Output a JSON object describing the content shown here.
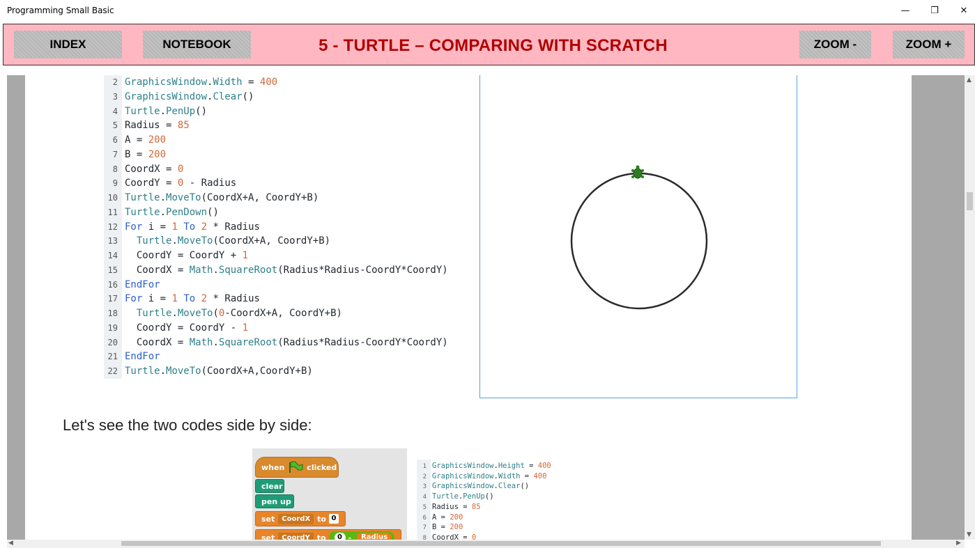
{
  "window": {
    "title": "Programming Small Basic",
    "minimize": "—",
    "restore": "❐",
    "close": "✕"
  },
  "toolbar": {
    "index_label": "INDEX",
    "notebook_label": "NOTEBOOK",
    "heading": "5 - TURTLE – COMPARING WITH SCRATCH",
    "zoom_out_label": "ZOOM -",
    "zoom_in_label": "ZOOM +"
  },
  "code_listing": {
    "lines": [
      {
        "n": "2",
        "text": "GraphicsWindow.Width = 400"
      },
      {
        "n": "3",
        "text": "GraphicsWindow.Clear()"
      },
      {
        "n": "4",
        "text": "Turtle.PenUp()"
      },
      {
        "n": "5",
        "text": "Radius = 85"
      },
      {
        "n": "6",
        "text": "A = 200"
      },
      {
        "n": "7",
        "text": "B = 200"
      },
      {
        "n": "8",
        "text": "CoordX = 0"
      },
      {
        "n": "9",
        "text": "CoordY = 0 - Radius"
      },
      {
        "n": "10",
        "text": "Turtle.MoveTo(CoordX+A, CoordY+B)"
      },
      {
        "n": "11",
        "text": "Turtle.PenDown()"
      },
      {
        "n": "12",
        "text": "For i = 1 To 2 * Radius"
      },
      {
        "n": "13",
        "text": "  Turtle.MoveTo(CoordX+A, CoordY+B)"
      },
      {
        "n": "14",
        "text": "  CoordY = CoordY + 1"
      },
      {
        "n": "15",
        "text": "  CoordX = Math.SquareRoot(Radius*Radius-CoordY*CoordY)"
      },
      {
        "n": "16",
        "text": "EndFor"
      },
      {
        "n": "17",
        "text": "For i = 1 To 2 * Radius"
      },
      {
        "n": "18",
        "text": "  Turtle.MoveTo(0-CoordX+A, CoordY+B)"
      },
      {
        "n": "19",
        "text": "  CoordY = CoordY - 1"
      },
      {
        "n": "20",
        "text": "  CoordX = Math.SquareRoot(Radius*Radius-CoordY*CoordY)"
      },
      {
        "n": "21",
        "text": "EndFor"
      },
      {
        "n": "22",
        "text": "Turtle.MoveTo(CoordX+A,CoordY+B)"
      }
    ]
  },
  "paragraph": "Let's see the two codes side by side:",
  "scratch": {
    "when_clicked_prefix": "when",
    "when_clicked_suffix": "clicked",
    "clear": "clear",
    "pen_up": "pen up",
    "set1_prefix": "set",
    "set1_var": "CoordX",
    "set1_to": "to",
    "set1_value": "0",
    "set2_prefix": "set",
    "set2_var": "CoordY",
    "set2_to": "to",
    "set2_value": "0",
    "set2_op": "-",
    "set2_rhs": "Radius"
  },
  "mini_code": {
    "lines": [
      {
        "n": "1",
        "text": "GraphicsWindow.Height = 400"
      },
      {
        "n": "2",
        "text": "GraphicsWindow.Width = 400"
      },
      {
        "n": "3",
        "text": "GraphicsWindow.Clear()"
      },
      {
        "n": "4",
        "text": "Turtle.PenUp()"
      },
      {
        "n": "5",
        "text": "Radius = 85"
      },
      {
        "n": "6",
        "text": "A = 200"
      },
      {
        "n": "7",
        "text": "B = 200"
      },
      {
        "n": "8",
        "text": "CoordX = 0"
      }
    ]
  },
  "colors": {
    "toolbar_bg": "#ffb7c1",
    "heading": "#b00000",
    "code_object": "#2f7f8a",
    "code_number": "#d2683a",
    "code_keyword": "#2a5fcc"
  }
}
